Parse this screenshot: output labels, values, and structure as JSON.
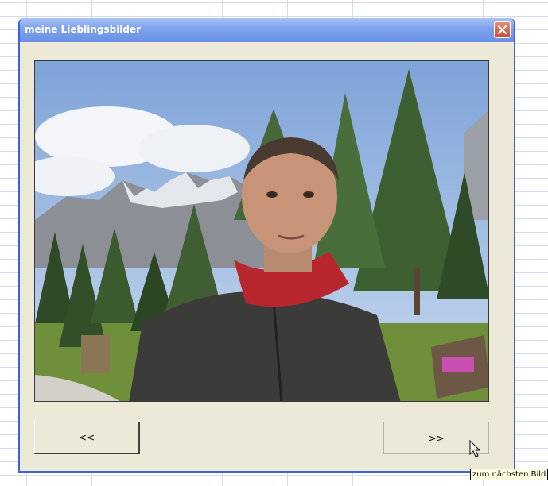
{
  "dialog": {
    "title": "meine Lieblingsbilder",
    "close_icon": "close-icon"
  },
  "photo": {
    "subject": "man-with-red-bandana-in-mountain-landscape"
  },
  "buttons": {
    "previous_label": "<<",
    "next_label": ">>"
  },
  "tooltip": {
    "text": "zum nächsten Bild"
  },
  "colors": {
    "titlebar": "#7fa3ec",
    "dialog_face": "#ece9d8",
    "close_button": "#c94b30",
    "tooltip_bg": "#ffffe1"
  }
}
